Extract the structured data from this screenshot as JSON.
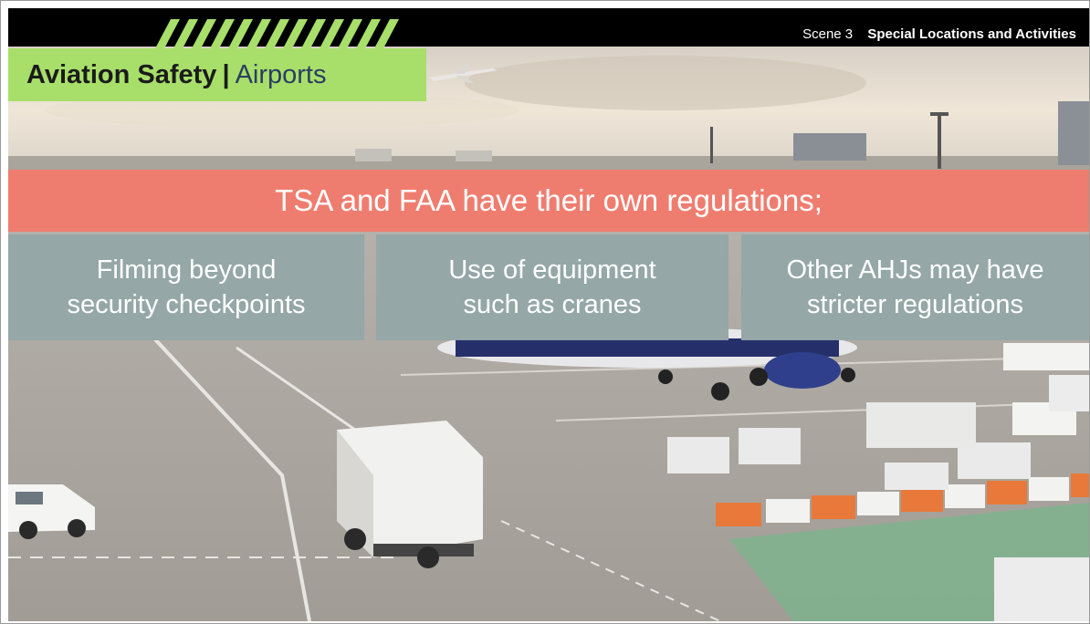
{
  "header": {
    "scene_number": "Scene 3",
    "scene_title": "Special Locations and Activities"
  },
  "title": {
    "main": "Aviation Safety",
    "separator": "|",
    "sub": "Airports"
  },
  "banner": {
    "text": "TSA and FAA have their own regulations;"
  },
  "points": [
    {
      "line1": "Filming beyond",
      "line2": "security checkpoints"
    },
    {
      "line1": "Use of equipment",
      "line2": "such as cranes"
    },
    {
      "line1": "Other AHJs may have",
      "line2": "stricter regulations"
    }
  ],
  "colors": {
    "topbar": "#000000",
    "title_bg": "#a8df6a",
    "banner_bg": "#ef7d6f",
    "box_bg": "#95a7a7",
    "accent_subtitle": "#2b3d63"
  }
}
